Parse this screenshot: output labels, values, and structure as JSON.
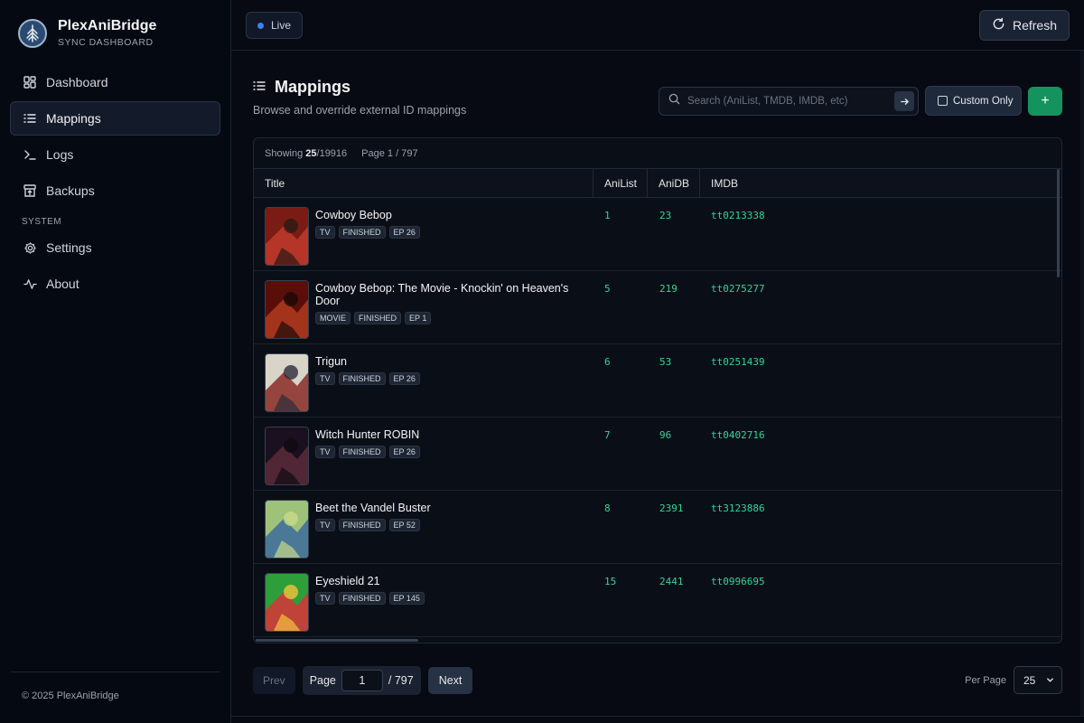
{
  "brand": {
    "title": "PlexAniBridge",
    "subtitle": "SYNC DASHBOARD"
  },
  "nav": {
    "items": [
      {
        "label": "Dashboard",
        "icon": "grid-icon",
        "active": false
      },
      {
        "label": "Mappings",
        "icon": "list-icon",
        "active": true
      },
      {
        "label": "Logs",
        "icon": "terminal-icon",
        "active": false
      },
      {
        "label": "Backups",
        "icon": "archive-icon",
        "active": false
      }
    ],
    "section_label": "SYSTEM",
    "system_items": [
      {
        "label": "Settings",
        "icon": "gear-icon"
      },
      {
        "label": "About",
        "icon": "activity-icon"
      }
    ]
  },
  "footer": {
    "copyright": "© 2025 PlexAniBridge"
  },
  "topbar": {
    "status_label": "Live",
    "refresh_label": "Refresh",
    "status_color": "#3b82f6"
  },
  "page": {
    "title": "Mappings",
    "subtitle": "Browse and override external ID mappings"
  },
  "search": {
    "placeholder": "Search (AniList, TMDB, IMDB, etc)",
    "value": ""
  },
  "filters": {
    "custom_only_label": "Custom Only",
    "custom_only_checked": false,
    "add_label": "+"
  },
  "table": {
    "showing_label": "Showing",
    "showing_count": "25",
    "showing_total": "/19916",
    "page_info": "Page 1 / 797",
    "columns": [
      "Title",
      "AniList",
      "AniDB",
      "IMDB"
    ],
    "rows": [
      {
        "title": "Cowboy Bebop",
        "tags": [
          "TV",
          "FINISHED",
          "EP 26"
        ],
        "anilist": "1",
        "anidb": "23",
        "imdb": "tt0213338",
        "poster": [
          "#7a1c14",
          "#c0392b",
          "#2b1a14"
        ]
      },
      {
        "title": "Cowboy Bebop: The Movie - Knockin' on Heaven's Door",
        "tags": [
          "MOVIE",
          "FINISHED",
          "EP 1"
        ],
        "anilist": "5",
        "anidb": "219",
        "imdb": "tt0275277",
        "poster": [
          "#5a0e0a",
          "#b23a1e",
          "#1a0a08"
        ]
      },
      {
        "title": "Trigun",
        "tags": [
          "TV",
          "FINISHED",
          "EP 26"
        ],
        "anilist": "6",
        "anidb": "53",
        "imdb": "tt0251439",
        "poster": [
          "#d9d4c8",
          "#8a2a26",
          "#2c2c3a"
        ]
      },
      {
        "title": "Witch Hunter ROBIN",
        "tags": [
          "TV",
          "FINISHED",
          "EP 26"
        ],
        "anilist": "7",
        "anidb": "96",
        "imdb": "tt0402716",
        "poster": [
          "#1a1020",
          "#5c2a3a",
          "#0e0a12"
        ]
      },
      {
        "title": "Beet the Vandel Buster",
        "tags": [
          "TV",
          "FINISHED",
          "EP 52"
        ],
        "anilist": "8",
        "anidb": "2391",
        "imdb": "tt3123886",
        "poster": [
          "#9ec27a",
          "#3d6b9e",
          "#c9d98a"
        ]
      },
      {
        "title": "Eyeshield 21",
        "tags": [
          "TV",
          "FINISHED",
          "EP 145"
        ],
        "anilist": "15",
        "anidb": "2441",
        "imdb": "tt0996695",
        "poster": [
          "#2e9e3a",
          "#d8323a",
          "#f3c33a"
        ]
      }
    ]
  },
  "pagination": {
    "prev_label": "Prev",
    "page_label": "Page",
    "page_value": "1",
    "page_total": "/ 797",
    "next_label": "Next",
    "per_page_label": "Per Page",
    "per_page_value": "25"
  },
  "colors": {
    "accent_green": "#15935f",
    "id_green": "#34d399",
    "background": "#070a12"
  }
}
